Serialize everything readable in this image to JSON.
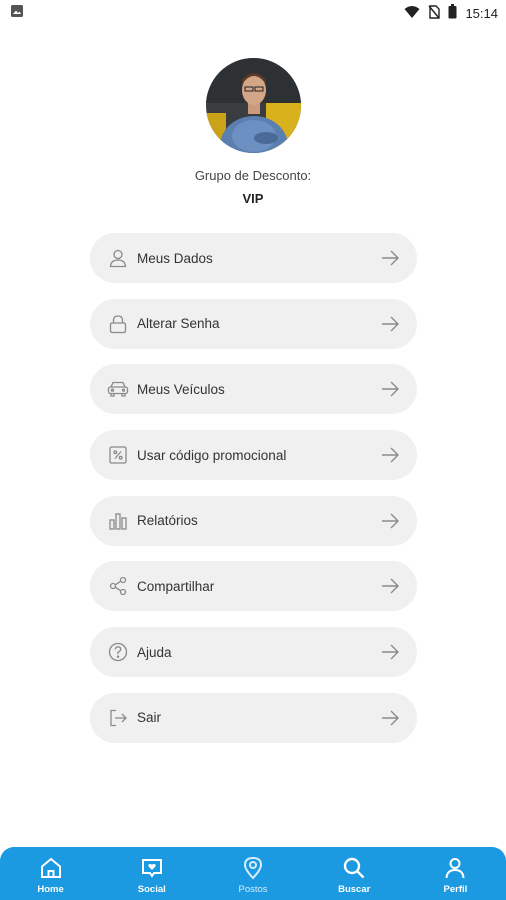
{
  "status_bar": {
    "time": "15:14"
  },
  "profile": {
    "group_label": "Grupo de Desconto:",
    "group_value": "VIP"
  },
  "menu": [
    {
      "label": "Meus Dados",
      "icon": "user-icon"
    },
    {
      "label": "Alterar Senha",
      "icon": "lock-icon"
    },
    {
      "label": "Meus Veículos",
      "icon": "car-icon"
    },
    {
      "label": "Usar código promocional",
      "icon": "percent-icon"
    },
    {
      "label": "Relatórios",
      "icon": "bar-chart-icon"
    },
    {
      "label": "Compartilhar",
      "icon": "share-icon"
    },
    {
      "label": "Ajuda",
      "icon": "help-icon"
    },
    {
      "label": "Sair",
      "icon": "logout-icon"
    }
  ],
  "bottom_nav": [
    {
      "label": "Home",
      "icon": "home-icon"
    },
    {
      "label": "Social",
      "icon": "social-icon"
    },
    {
      "label": "Postos",
      "icon": "location-pin-icon"
    },
    {
      "label": "Buscar",
      "icon": "search-icon"
    },
    {
      "label": "Perfil",
      "icon": "person-icon"
    }
  ],
  "colors": {
    "accent": "#1b9ae2",
    "menu_bg": "#f0f0f0",
    "text": "#333333"
  }
}
